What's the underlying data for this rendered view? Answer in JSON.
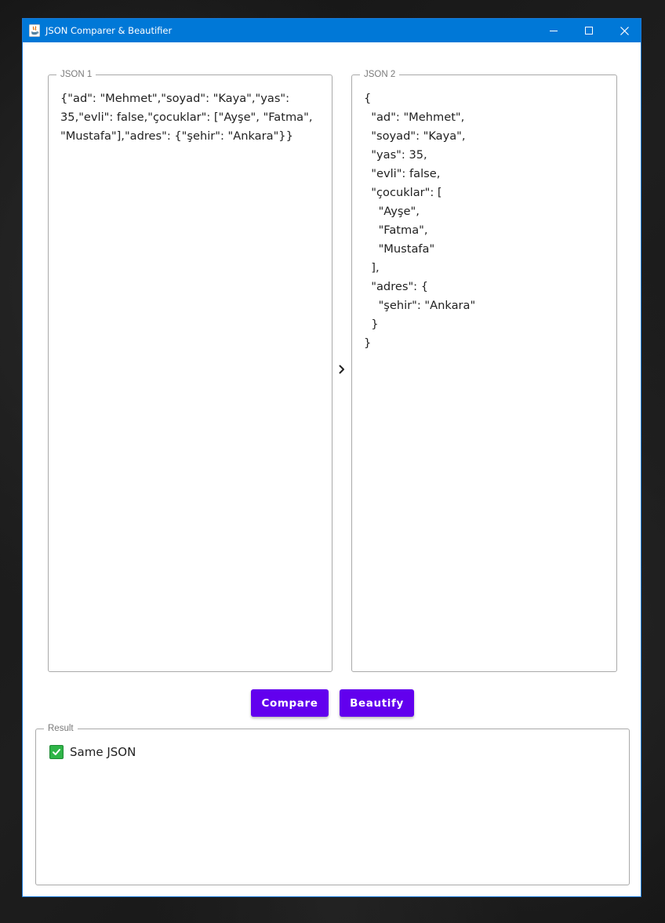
{
  "window": {
    "title": "JSON Comparer & Beautifier",
    "accent_color": "#0078d7",
    "controls": {
      "minimize_icon": "minimize-icon",
      "maximize_icon": "maximize-icon",
      "close_icon": "close-icon"
    }
  },
  "json1": {
    "label": "JSON 1",
    "content": "{\"ad\": \"Mehmet\",\"soyad\": \"Kaya\",\"yas\": 35,\"evli\": false,\"çocuklar\": [\"Ayşe\", \"Fatma\", \"Mustafa\"],\"adres\": {\"şehir\": \"Ankara\"}}"
  },
  "json2": {
    "label": "JSON 2",
    "content": "{\n  \"ad\": \"Mehmet\",\n  \"soyad\": \"Kaya\",\n  \"yas\": 35,\n  \"evli\": false,\n  \"çocuklar\": [\n    \"Ayşe\",\n    \"Fatma\",\n    \"Mustafa\"\n  ],\n  \"adres\": {\n    \"şehir\": \"Ankara\"\n  }\n}"
  },
  "divider": {
    "icon": "chevron-right-icon"
  },
  "buttons": {
    "compare_label": "Compare",
    "beautify_label": "Beautify",
    "color": "#6200ee"
  },
  "result": {
    "label": "Result",
    "status_icon": "check-icon",
    "status_color": "#2fb548",
    "message": "Same JSON"
  }
}
